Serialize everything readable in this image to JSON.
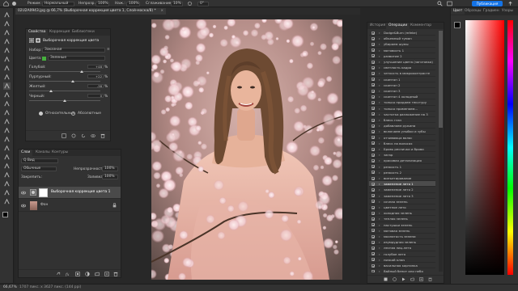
{
  "optionbar": {
    "mode_label": "Режим:",
    "mode_value": "Нормальный",
    "opacity_label": "Непрозр.:",
    "opacity_value": "100%",
    "pressure_label": "Наж.:",
    "pressure_value": "100%",
    "smoothing_label": "Сглаживание:",
    "smoothing_value": "10%",
    "angle_value": "0°",
    "publish_label": "Публикация"
  },
  "document": {
    "tab_title": "02U2A0943.jpg @ 66,7% (Выборочная коррекция цвета 1, Слой-маска/8) *"
  },
  "properties": {
    "tabs": [
      "Свойства",
      "Коррекция",
      "Библиотеки"
    ],
    "title": "Выборочная коррекция цвета",
    "preset_label": "Набор:",
    "preset_value": "Заказная",
    "colors_label": "Цвета:",
    "colors_value": "Зеленые",
    "sliders": [
      {
        "label": "Голубой:",
        "value": "+48",
        "fraction": 0.74
      },
      {
        "label": "Пурпурный:",
        "value": "+22",
        "fraction": 0.61
      },
      {
        "label": "Желтый:",
        "value": "-38",
        "fraction": 0.31
      },
      {
        "label": "Черный:",
        "value": "0",
        "fraction": 0.5
      }
    ],
    "relative_label": "Относительные",
    "absolute_label": "Абсолютные"
  },
  "layers": {
    "tabs": [
      "Слои",
      "Каналы",
      "Контуры"
    ],
    "filter_label": "Q Вид",
    "blend_value": "Обычные",
    "opacity_label": "Непрозрачность:",
    "opacity_value": "100%",
    "lock_label": "Закрепить:",
    "fill_label": "Заливка:",
    "fill_value": "100%",
    "items": [
      {
        "name": "Выборочная коррекция цвета 1",
        "selected": true
      },
      {
        "name": "Фон",
        "selected": false
      }
    ]
  },
  "history": {
    "tabs": [
      "История",
      "Операции",
      "Комментар"
    ],
    "items": [
      "Dodge&Burn (mfeke)",
      "объемный туман",
      "убираем шумы",
      "матовость 1",
      "развитие 2",
      "улучшение цвета (заготовка)",
      "светлость кадра",
      "четкость в микроконтрасте",
      "скинтон 1",
      "скинтон 2",
      "скинтон 3",
      "скинтон 4 холодный",
      "только придаем текстуру",
      "только применяем...",
      "частотка разложение на 3",
      "блеск глаз",
      "добавляем ружина",
      "включаем улыбки и зубы",
      "отчиваюца волос",
      "блеск на волосах",
      "Бровь реснички и брови",
      "загар",
      "красивая детализация",
      "резкость 1",
      "резкость 2",
      "винъетирование",
      "заменение лето 1",
      "заменение лето 2",
      "заменение лето 3",
      "сочная зелень",
      "цветное лето",
      "холодная зелень",
      "теплая зелень",
      "пастушьи зелень",
      "матовая зелень",
      "мохнатость зелени",
      "изумрудная зелень",
      "лесная лиц-лето",
      "голубое лето",
      "низкий ключ",
      "васильная картинка",
      "Вайный бенит или небо"
    ],
    "selected_index": 26
  },
  "color": {
    "tabs": [
      "Цвет",
      "Образцы",
      "Градиен",
      "Узоры"
    ],
    "fg": "#000000",
    "bg": "#ffffff",
    "hue_accent": "#e00000"
  },
  "status": {
    "zoom": "66,67%",
    "info": "1707 пикс. x 3627 пикс. (144 ppi)"
  }
}
